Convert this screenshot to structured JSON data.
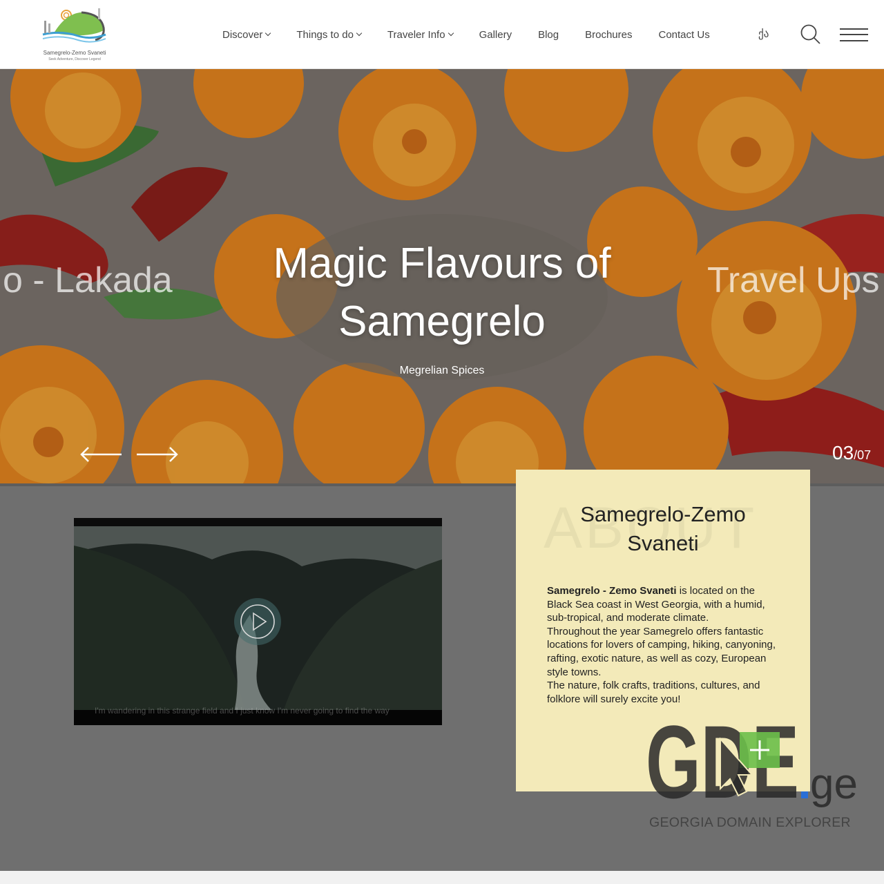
{
  "header": {
    "logo": {
      "title": "Samegrelo-Zemo Svaneti",
      "tagline": "Seek Adventure, Discover Legend"
    },
    "nav": [
      {
        "label": "Discover",
        "has_dropdown": true
      },
      {
        "label": "Things to do",
        "has_dropdown": true
      },
      {
        "label": "Traveler Info",
        "has_dropdown": true
      },
      {
        "label": "Gallery",
        "has_dropdown": false
      },
      {
        "label": "Blog",
        "has_dropdown": false
      },
      {
        "label": "Brochures",
        "has_dropdown": false
      },
      {
        "label": "Contact Us",
        "has_dropdown": false
      }
    ],
    "language": "ქა",
    "icons": {
      "search": "search-icon",
      "menu": "hamburger-menu-icon"
    }
  },
  "hero": {
    "title_line1": "Magic Flavours of",
    "title_line2": "Samegrelo",
    "subtitle": "Megrelian Spices",
    "prev_slide_text": "o - Lakada",
    "next_slide_text": "Travel Ups",
    "counter_current": "03",
    "counter_total": "/07",
    "icons": {
      "prev": "arrow-left-icon",
      "next": "arrow-right-icon"
    }
  },
  "video": {
    "caption": "I'm wandering in this strange field and I just know I'm never going to find the way",
    "icons": {
      "play": "play-icon"
    }
  },
  "about": {
    "ghost_word": "ABOUT",
    "title_line1": "Samegrelo-Zemo",
    "title_line2": "Svaneti",
    "lead_bold": "Samegrelo - Zemo Svaneti",
    "lead_rest": " is located on the Black Sea coast in West Georgia, with a humid, sub-tropical, and moderate climate.",
    "paragraph2": "Throughout the year Samegrelo offers fantastic locations for lovers of camping, hiking, canyoning, rafting, exotic nature, as well as cozy, European style towns.",
    "paragraph3": "The nature, folk crafts, traditions, cultures, and folklore will surely excite you!"
  },
  "watermark": {
    "brand": "GDE",
    "tld": "ge",
    "subtitle": "GEORGIA DOMAIN EXPLORER"
  },
  "colors": {
    "about_bg": "#f3eab9",
    "lower_bg": "#6f6f6f",
    "nav_text": "#444444",
    "accent_green": "#6bbf4a",
    "accent_blue": "#2a6fd6"
  }
}
